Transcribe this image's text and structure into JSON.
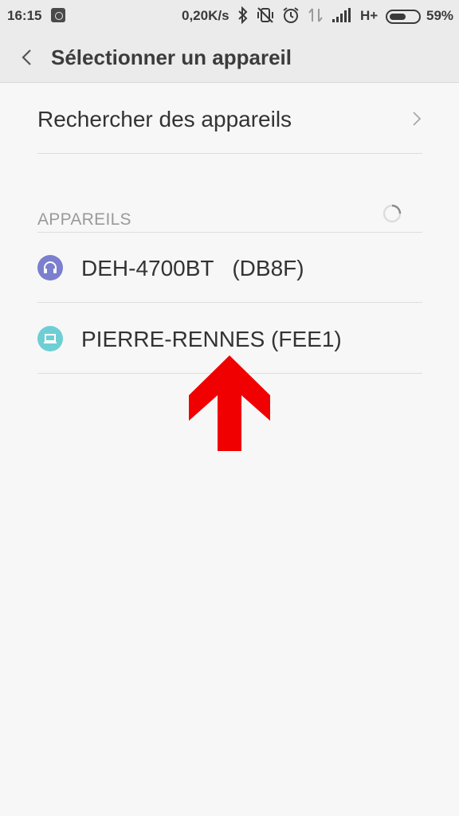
{
  "status_bar": {
    "time": "16:15",
    "network_speed": "0,20K/s",
    "network_type": "H+",
    "battery_percent": "59%",
    "battery_level": 0.59,
    "icons": [
      "app-notification-icon",
      "bluetooth-icon",
      "vibrate-off-icon",
      "alarm-icon",
      "no-data-icon",
      "signal-icon",
      "battery-icon"
    ]
  },
  "header": {
    "title": "Sélectionner un appareil",
    "back_icon": "chevron-left-icon"
  },
  "search": {
    "label": "Rechercher des appareils"
  },
  "devices_section": {
    "title": "APPAREILS",
    "loading": true,
    "items": [
      {
        "name": "DEH-4700BT   (DB8F)",
        "icon": "headset-icon",
        "color": "#7b7fce"
      },
      {
        "name": "PIERRE-RENNES (FEE1)",
        "icon": "laptop-icon",
        "color": "#6dcfd4"
      }
    ]
  },
  "annotation": {
    "arrow_color": "#f00000"
  }
}
